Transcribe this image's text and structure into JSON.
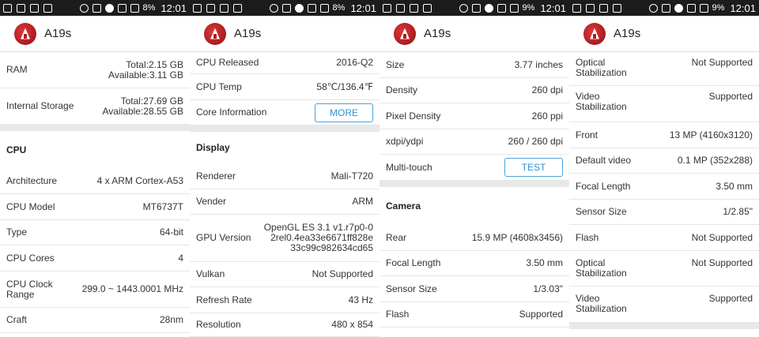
{
  "panels": [
    {
      "status": {
        "battery": "8%",
        "time": "12:01"
      },
      "app_title": "A19s",
      "rows": [
        {
          "label": "RAM",
          "value": "Total:2.15 GB\nAvailable:3.11 GB"
        },
        {
          "label": "Internal Storage",
          "value": "Total:27.69 GB\nAvailable:28.55 GB"
        }
      ],
      "section_title": "CPU",
      "section_rows": [
        {
          "label": "Architecture",
          "value": "4 x ARM Cortex-A53"
        },
        {
          "label": "CPU Model",
          "value": "MT6737T"
        },
        {
          "label": "Type",
          "value": "64-bit"
        },
        {
          "label": "CPU Cores",
          "value": "4"
        },
        {
          "label": "CPU Clock Range",
          "value": "299.0 ~ 1443.0001 MHz"
        },
        {
          "label": "Craft",
          "value": "28nm"
        }
      ]
    },
    {
      "status": {
        "battery": "8%",
        "time": "12:01"
      },
      "app_title": "A19s",
      "rows": [
        {
          "label": "CPU Released",
          "value": "2016-Q2"
        },
        {
          "label": "CPU Temp",
          "value": "58℃/136.4℉"
        },
        {
          "label": "Core Information",
          "button": "MORE"
        }
      ],
      "section_title": "Display",
      "section_rows": [
        {
          "label": "Renderer",
          "value": "Mali-T720"
        },
        {
          "label": "Vender",
          "value": "ARM"
        },
        {
          "label": "GPU Version",
          "value": "OpenGL ES 3.1 v1.r7p0-0\n2rel0.4ea33e6671ff828e\n33c99c982634cd65"
        },
        {
          "label": "Vulkan",
          "value": "Not Supported"
        },
        {
          "label": "Refresh Rate",
          "value": "43 Hz"
        },
        {
          "label": "Resolution",
          "value": "480 x 854"
        }
      ]
    },
    {
      "status": {
        "battery": "9%",
        "time": "12:01"
      },
      "app_title": "A19s",
      "rows": [
        {
          "label": "Size",
          "value": "3.77 inches"
        },
        {
          "label": "Density",
          "value": "260 dpi"
        },
        {
          "label": "Pixel Density",
          "value": "260 ppi"
        },
        {
          "label": "xdpi/ydpi",
          "value": "260 / 260 dpi"
        },
        {
          "label": "Multi-touch",
          "button": "TEST"
        }
      ],
      "section_title": "Camera",
      "section_rows": [
        {
          "label": "Rear",
          "value": "15.9 MP (4608x3456)"
        },
        {
          "label": "Focal Length",
          "value": "3.50 mm"
        },
        {
          "label": "Sensor Size",
          "value": "1/3.03\""
        },
        {
          "label": "Flash",
          "value": "Supported"
        }
      ]
    },
    {
      "status": {
        "battery": "9%",
        "time": "12:01"
      },
      "app_title": "A19s",
      "rows": [
        {
          "label": "Optical Stabilization",
          "value": "Not Supported"
        },
        {
          "label": "Video Stabilization",
          "value": "Supported"
        },
        {
          "label": "Front",
          "value": "13 MP (4160x3120)"
        },
        {
          "label": "Default video",
          "value": "0.1 MP (352x288)"
        },
        {
          "label": "Focal Length",
          "value": "3.50 mm"
        },
        {
          "label": "Sensor Size",
          "value": "1/2.85\""
        },
        {
          "label": "Flash",
          "value": "Not Supported"
        },
        {
          "label": "Optical Stabilization",
          "value": "Not Supported"
        },
        {
          "label": "Video Stabilization",
          "value": "Supported"
        }
      ]
    }
  ]
}
